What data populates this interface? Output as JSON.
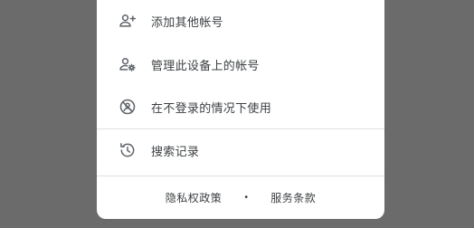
{
  "menu": {
    "items": [
      {
        "label": "添加其他帐号",
        "icon": "add-person-icon"
      },
      {
        "label": "管理此设备上的帐号",
        "icon": "manage-accounts-icon"
      },
      {
        "label": "在不登录的情况下使用",
        "icon": "no-account-icon"
      },
      {
        "label": "搜索记录",
        "icon": "history-icon"
      }
    ]
  },
  "footer": {
    "privacy": "隐私权政策",
    "separator": "•",
    "terms": "服务条款"
  },
  "colors": {
    "backdrop": "#6b6b6b",
    "card": "#ffffff",
    "text": "#3c4043",
    "icon": "#5f6368",
    "divider": "#e0e0e0"
  }
}
